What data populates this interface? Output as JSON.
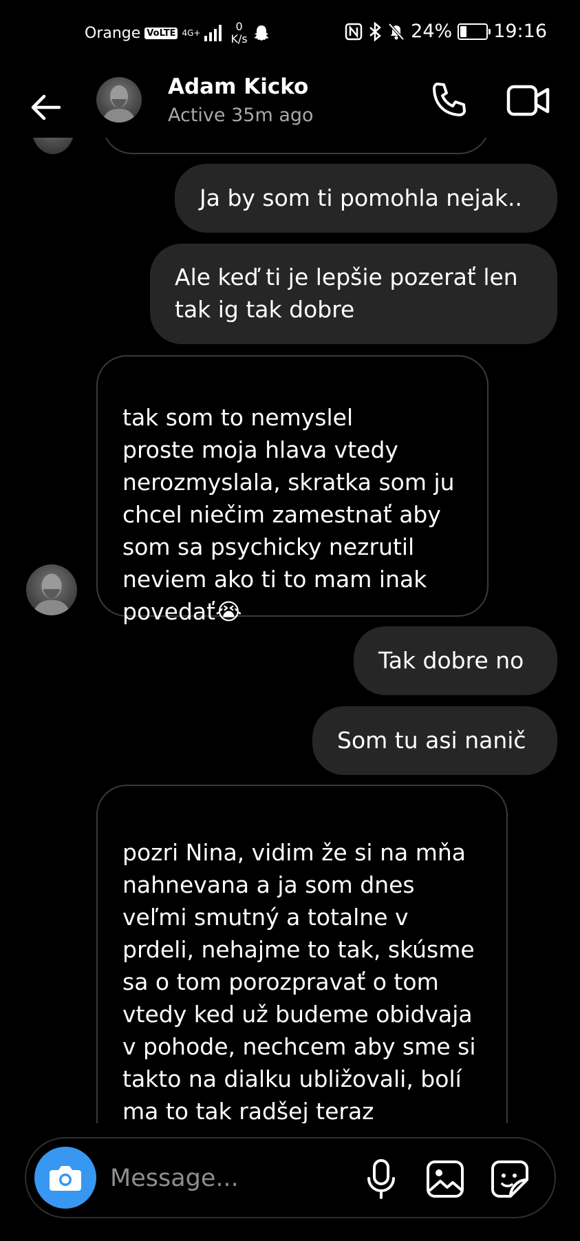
{
  "status_bar": {
    "carrier": "Orange",
    "volte": "VoLTE",
    "network": "4G+",
    "speed_value": "0",
    "speed_unit": "K/s",
    "battery": "24%",
    "battery_level": 0.24,
    "time": "19:16"
  },
  "header": {
    "contact_name": "Adam Kicko",
    "activity": "Active 35m ago"
  },
  "messages": [
    {
      "direction": "sent",
      "text": "Ja by som ti pomohla nejak.."
    },
    {
      "direction": "sent",
      "text": "Ale keď ti je lepšie pozerať len tak ig tak dobre"
    },
    {
      "direction": "received",
      "text": "tak som to nemyslel\nproste moja hlava vtedy nerozmyslala, skratka som ju chcel niečim zamestnať aby som sa psychicky nezrutil\nneviem ako ti to mam inak povedať😭"
    },
    {
      "direction": "sent",
      "text": "Tak dobre no"
    },
    {
      "direction": "sent",
      "text": "Som tu asi nanič"
    },
    {
      "direction": "received",
      "text": "pozri Nina, vidim že si na mňa nahnevana a ja som dnes veľmi smutný a totalne v prdeli, nehajme to tak, skúsme sa o tom porozpravať o tom vtedy ked už budeme obidvaja v pohode, nechcem aby sme si takto na dialku ubližovali, bolí ma to tak radšej teraz prestaňme, boli by škoda keby"
    }
  ],
  "composer": {
    "placeholder": "Message..."
  },
  "colors": {
    "background": "#000000",
    "sent_bubble": "#262626",
    "camera_button": "#3897f0",
    "muted_text": "#a8a8a8"
  }
}
